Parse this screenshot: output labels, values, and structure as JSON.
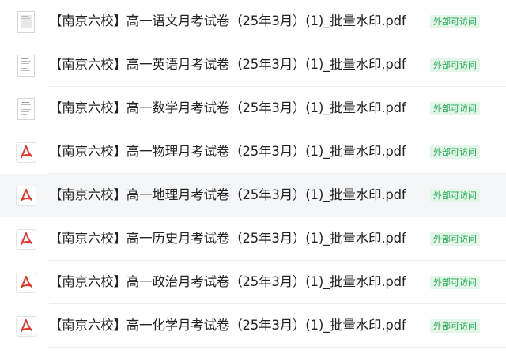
{
  "files": [
    {
      "name": "【南京六校】高一语文月考试卷（25年3月）(1)_批量水印.pdf",
      "badge": "外部可访问",
      "icon": "document-thumbnail-icon"
    },
    {
      "name": "【南京六校】高一英语月考试卷（25年3月）(1)_批量水印.pdf",
      "badge": "外部可访问",
      "icon": "document-thumbnail-icon"
    },
    {
      "name": "【南京六校】高一数学月考试卷（25年3月）(1)_批量水印.pdf",
      "badge": "外部可访问",
      "icon": "document-thumbnail-icon"
    },
    {
      "name": "【南京六校】高一物理月考试卷（25年3月）(1)_批量水印.pdf",
      "badge": "外部可访问",
      "icon": "pdf-icon"
    },
    {
      "name": "【南京六校】高一地理月考试卷（25年3月）(1)_批量水印.pdf",
      "badge": "外部可访问",
      "icon": "pdf-icon",
      "hovered": true
    },
    {
      "name": "【南京六校】高一历史月考试卷（25年3月）(1)_批量水印.pdf",
      "badge": "外部可访问",
      "icon": "pdf-icon"
    },
    {
      "name": "【南京六校】高一政治月考试卷（25年3月）(1)_批量水印.pdf",
      "badge": "外部可访问",
      "icon": "pdf-icon"
    },
    {
      "name": "【南京六校】高一化学月考试卷（25年3月）(1)_批量水印.pdf",
      "badge": "外部可访问",
      "icon": "pdf-icon"
    }
  ],
  "colors": {
    "pdf_icon": "#e2362f",
    "badge_text": "#23a855",
    "badge_bg": "#e3f6e8",
    "hover_row": "#f5f6f7"
  }
}
